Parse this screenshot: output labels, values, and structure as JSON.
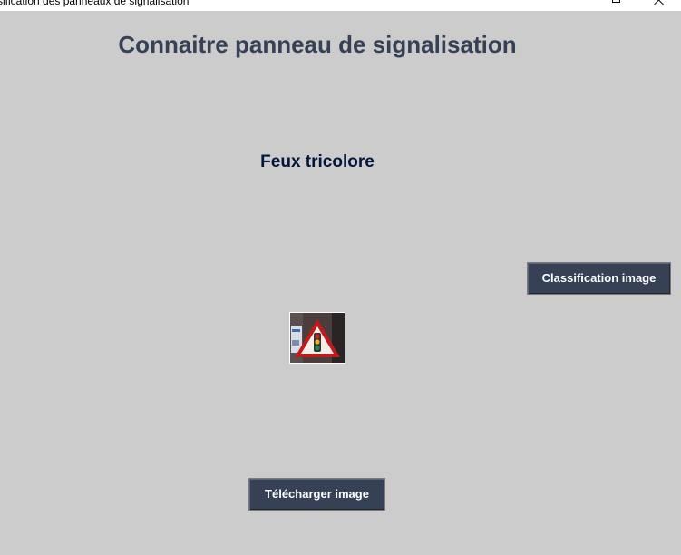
{
  "window": {
    "title": "ssification des panneaux de signalisation"
  },
  "heading": "Connaitre panneau de signalisation",
  "result": {
    "label": "Feux tricolore"
  },
  "buttons": {
    "classify": "Classification image",
    "upload": "Télécharger image"
  },
  "image": {
    "icon": "traffic-light-warning-sign-icon"
  },
  "colors": {
    "background": "#cccccc",
    "heading": "#364156",
    "label": "#011638",
    "button_bg": "#364156",
    "button_text": "#ffffff"
  }
}
